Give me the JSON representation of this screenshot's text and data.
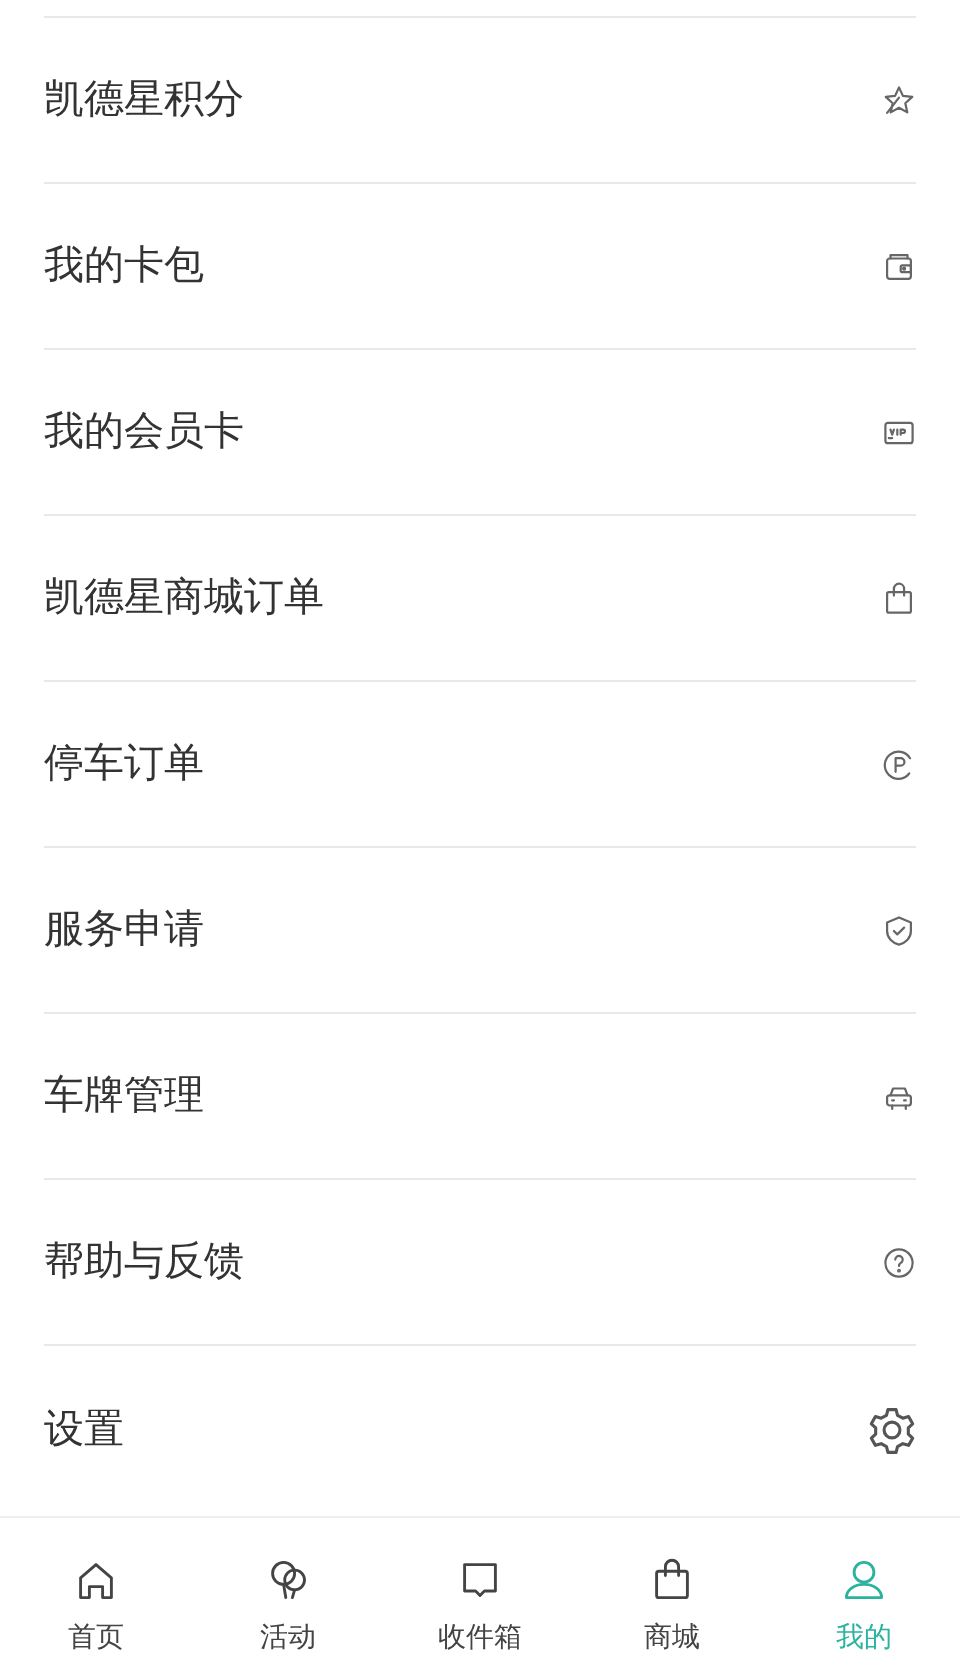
{
  "menu": [
    {
      "label": "凯德星积分",
      "kind": "star"
    },
    {
      "label": "我的卡包",
      "kind": "wallet"
    },
    {
      "label": "我的会员卡",
      "kind": "vip"
    },
    {
      "label": "凯德星商城订单",
      "kind": "bag"
    },
    {
      "label": "停车订单",
      "kind": "parking"
    },
    {
      "label": "服务申请",
      "kind": "shield"
    },
    {
      "label": "车牌管理",
      "kind": "car"
    },
    {
      "label": "帮助与反馈",
      "kind": "help"
    },
    {
      "label": "设置",
      "kind": "gear"
    }
  ],
  "tab_bar": [
    {
      "label": "首页",
      "kind": "home",
      "selected": false
    },
    {
      "label": "活动",
      "kind": "balloons",
      "selected": false
    },
    {
      "label": "收件箱",
      "kind": "inbox",
      "selected": false
    },
    {
      "label": "商城",
      "kind": "bag",
      "selected": false
    },
    {
      "label": "我的",
      "kind": "user",
      "selected": true
    }
  ]
}
